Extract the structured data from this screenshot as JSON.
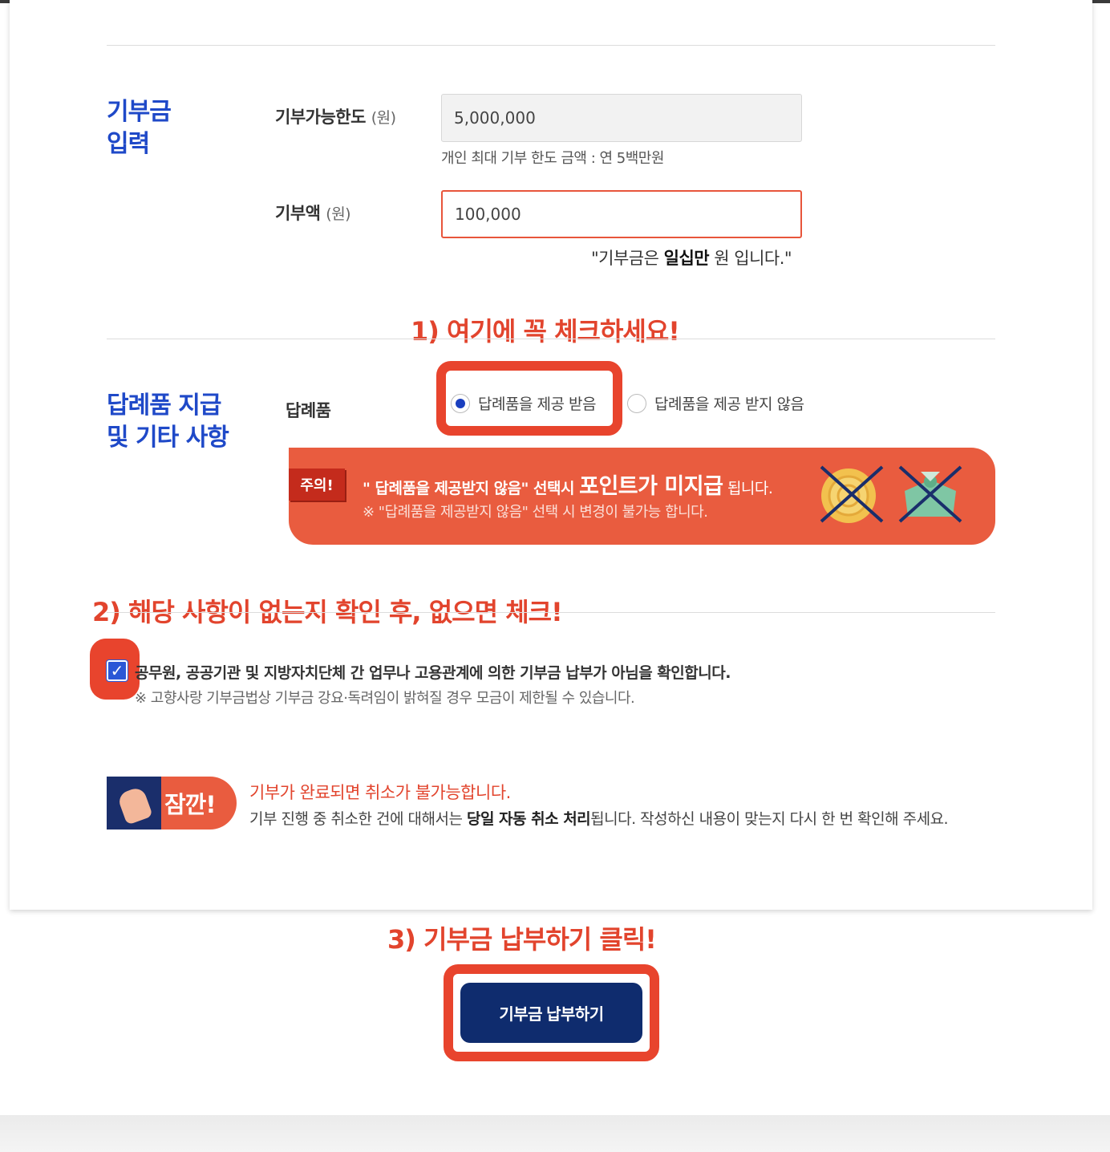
{
  "donation_section": {
    "title": "기부금\n입력",
    "limit_label": "기부가능한도",
    "limit_unit": "(원)",
    "limit_value": "5,000,000",
    "limit_hint": "개인 최대 기부 한도 금액 : 연 5백만원",
    "amount_label": "기부액",
    "amount_unit": "(원)",
    "amount_value": "100,000",
    "amount_text_pre": "\"기부금은 ",
    "amount_text_bold": "일십만",
    "amount_text_post": " 원 입니다.\""
  },
  "annotations": {
    "step1": "1) 여기에 꼭 체크하세요!",
    "step2": "2) 해당 사항이 없는지 확인 후, 없으면 체크!",
    "step3": "3) 기부금 납부하기 클릭!"
  },
  "gift_section": {
    "title": "답례품 지급\n및 기타 사항",
    "label": "답례품",
    "option_receive": "답례품을 제공 받음",
    "option_decline": "답례품을 제공 받지 않음",
    "selected": "답례품을 제공 받음"
  },
  "warning": {
    "tag": "주의!",
    "line1_pre": "\" 답례품을 제공받지 않음\" 선택시 ",
    "line1_big": "포인트가 미지급",
    "line1_post": " 됩니다.",
    "line2": "※ \"답례품을 제공받지 않음\" 선택 시 변경이 불가능 합니다.",
    "icons": [
      "coin-crossed-icon",
      "gift-crossed-icon"
    ]
  },
  "confirm": {
    "checked": true,
    "text": "공무원, 공공기관 및 지방자치단체 간 업무나 고용관계에 의한 기부금 납부가 아님을 확인합니다.",
    "note": "※ 고향사랑 기부금법상 기부금 강요·독려임이 밝혀질 경우 모금이 제한될 수 있습니다."
  },
  "notice": {
    "badge": "잠깐!",
    "title": "기부가 완료되면 취소가 불가능합니다.",
    "desc_pre": "기부 진행 중 취소한 건에 대해서는 ",
    "desc_bold": "당일 자동 취소 처리",
    "desc_post": "됩니다. 작성하신 내용이 맞는지 다시 한 번 확인해 주세요."
  },
  "submit": {
    "label": "기부금 납부하기"
  },
  "colors": {
    "accent_blue": "#1f49c8",
    "annotation_red": "#e2442d",
    "warning_orange": "#e95c3f",
    "button_navy": "#0f2c6e"
  }
}
